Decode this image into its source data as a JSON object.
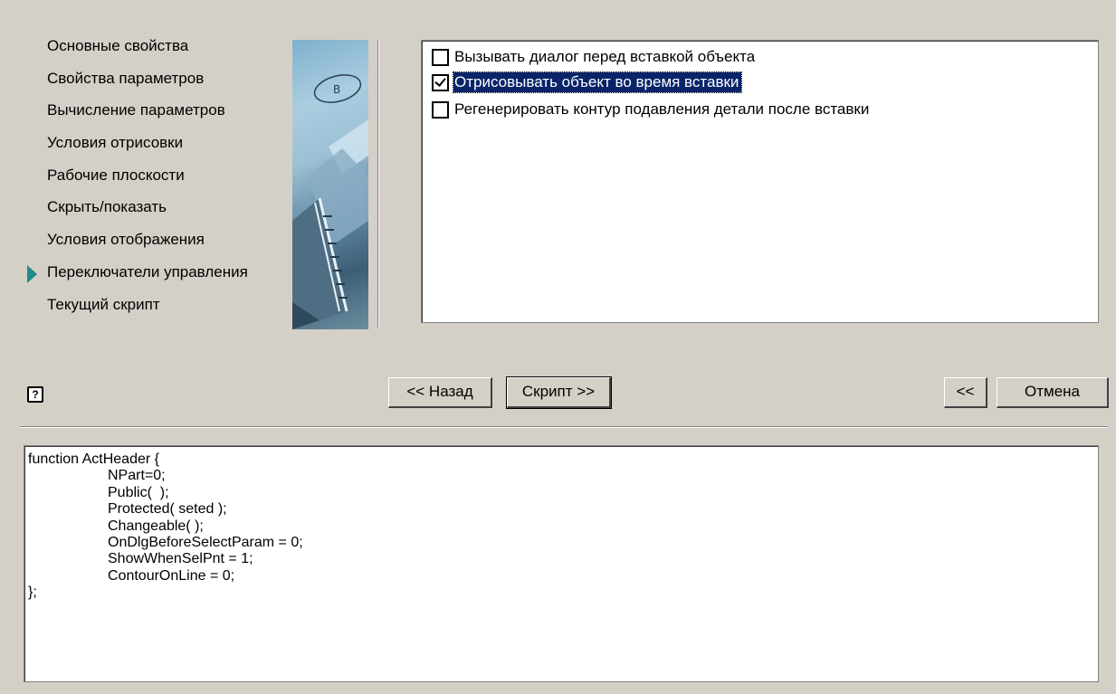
{
  "nav": {
    "items": [
      {
        "label": "Основные свойства"
      },
      {
        "label": "Свойства параметров"
      },
      {
        "label": "Вычисление параметров"
      },
      {
        "label": "Условия отрисовки"
      },
      {
        "label": "Рабочие плоскости"
      },
      {
        "label": "Скрыть/показать"
      },
      {
        "label": "Условия отображения"
      },
      {
        "label": "Переключатели управления",
        "active": true
      },
      {
        "label": "Текущий скрипт"
      }
    ]
  },
  "options": [
    {
      "label": "Вызывать диалог перед вставкой объекта",
      "checked": false
    },
    {
      "label": "Отрисовывать объект во время вставки",
      "checked": true,
      "selected": true
    },
    {
      "label": "Регенерировать контур подавления детали после вставки",
      "checked": false
    }
  ],
  "buttons": {
    "back": "<< Назад",
    "script": "Скрипт >>",
    "collapse": "<<",
    "cancel": "Отмена"
  },
  "help_icon": "?",
  "script": {
    "lines": [
      "function ActHeader {",
      "NPart=0;",
      "Public(  );",
      "Protected( seted );",
      "Changeable( );",
      "OnDlgBeforeSelectParam = 0;",
      "ShowWhenSelPnt = 1;",
      "ContourOnLine = 0;",
      "};"
    ]
  },
  "colors": {
    "dialog_bg": "#d4d0c8",
    "selection": "#0a246a",
    "nav_marker": "#1f8a8a"
  }
}
